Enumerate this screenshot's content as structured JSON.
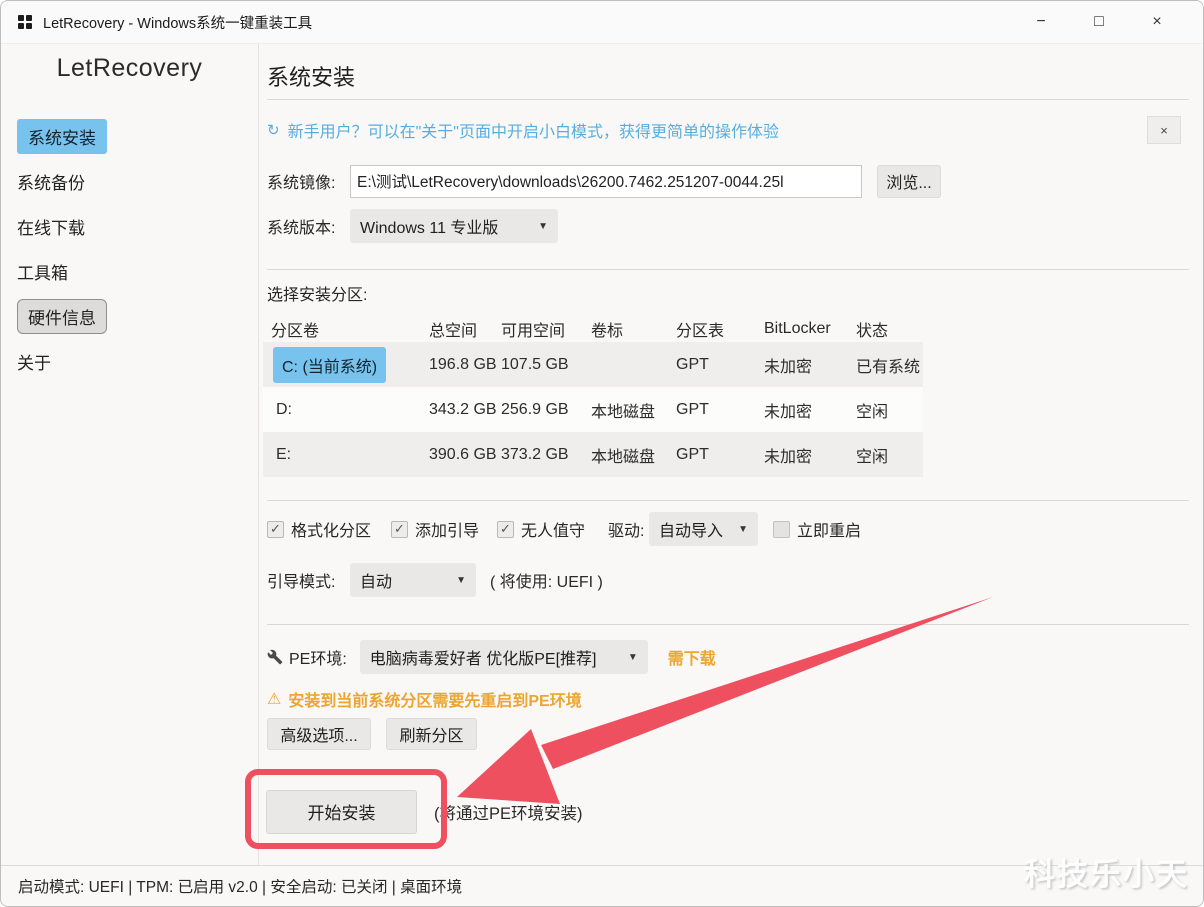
{
  "window": {
    "title": "LetRecovery - Windows系统一键重装工具",
    "controls": {
      "minimize": "−",
      "maximize": "□",
      "close": "×"
    }
  },
  "sidebar": {
    "logo": "LetRecovery",
    "items": [
      {
        "label": "系统安装",
        "active": true
      },
      {
        "label": "系统备份",
        "active": false
      },
      {
        "label": "在线下载",
        "active": false
      },
      {
        "label": "工具箱",
        "active": false
      },
      {
        "label": "硬件信息",
        "active": false
      },
      {
        "label": "关于",
        "active": false
      }
    ]
  },
  "main": {
    "page_title": "系统安装",
    "banner": {
      "text": "新手用户？可以在\"关于\"页面中开启小白模式，获得更简单的操作体验",
      "close_label": "×"
    },
    "image_row": {
      "label": "系统镜像:",
      "value": "E:\\测试\\LetRecovery\\downloads\\26200.7462.251207-0044.25l",
      "browse_label": "浏览..."
    },
    "version_row": {
      "label": "系统版本:",
      "value": "Windows 11 专业版"
    },
    "partition_section": {
      "title": "选择安装分区:",
      "headers": {
        "volume": "分区卷",
        "total": "总空间",
        "free": "可用空间",
        "label": "卷标",
        "table": "分区表",
        "bitlocker": "BitLocker",
        "status": "状态"
      },
      "rows": [
        {
          "volume": "C: (当前系统)",
          "total": "196.8 GB",
          "free": "107.5 GB",
          "label": "",
          "table": "GPT",
          "bitlocker": "未加密",
          "status": "已有系统",
          "selected": true
        },
        {
          "volume": "D:",
          "total": "343.2 GB",
          "free": "256.9 GB",
          "label": "本地磁盘",
          "table": "GPT",
          "bitlocker": "未加密",
          "status": "空闲",
          "selected": false
        },
        {
          "volume": "E:",
          "total": "390.6 GB",
          "free": "373.2 GB",
          "label": "本地磁盘",
          "table": "GPT",
          "bitlocker": "未加密",
          "status": "空闲",
          "selected": false
        }
      ]
    },
    "options": {
      "format_partition": "格式化分区",
      "add_boot": "添加引导",
      "unattended": "无人值守",
      "driver_label": "驱动:",
      "driver_value": "自动导入",
      "reboot_now": "立即重启",
      "boot_mode_label": "引导模式:",
      "boot_mode_value": "自动",
      "boot_mode_note": "( 将使用: UEFI )"
    },
    "pe": {
      "label": "PE环境:",
      "value": "电脑病毒爱好者 优化版PE[推荐]",
      "download_hint": "需下载",
      "warning": "安装到当前系统分区需要先重启到PE环境"
    },
    "buttons": {
      "advanced": "高级选项...",
      "refresh": "刷新分区",
      "install": "开始安装",
      "install_note": "(将通过PE环境安装)"
    }
  },
  "statusbar": {
    "text": "启动模式: UEFI | TPM: 已启用 v2.0 | 安全启动: 已关闭 | 桌面环境"
  },
  "watermark": "科技乐小天",
  "icons": {
    "hint": "↻",
    "chevron_down": "▼",
    "check": "✓",
    "warning": "⚠"
  },
  "colors": {
    "accent_blue": "#77c3ee",
    "banner_blue": "#56aede",
    "warning_orange": "#eca62f",
    "annotation_red": "#ee5060"
  }
}
